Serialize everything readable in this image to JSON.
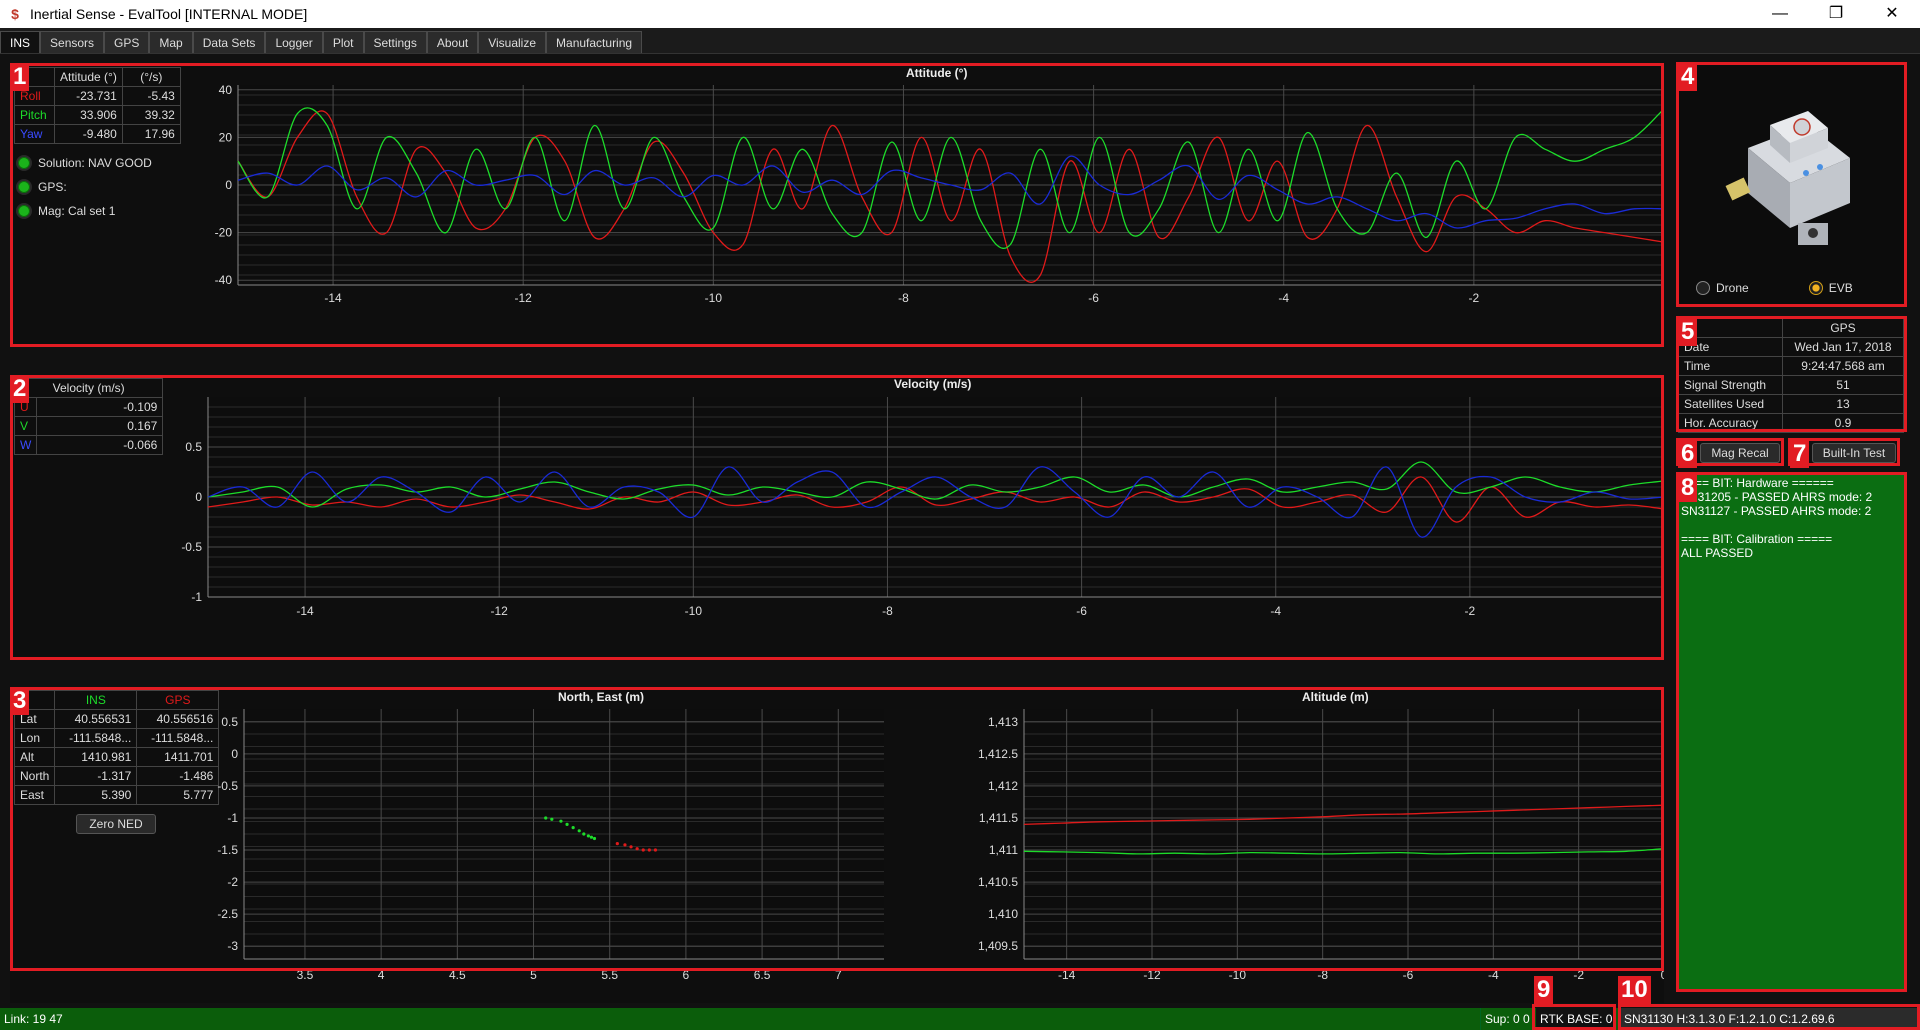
{
  "window": {
    "title": "Inertial Sense - EvalTool [INTERNAL MODE]",
    "minimize": "—",
    "maximize": "❐",
    "close": "✕"
  },
  "menu": [
    "INS",
    "Sensors",
    "GPS",
    "Map",
    "Data Sets",
    "Logger",
    "Plot",
    "Settings",
    "About",
    "Visualize",
    "Manufacturing"
  ],
  "badges": [
    "1",
    "2",
    "3",
    "4",
    "5",
    "6",
    "7",
    "8",
    "9",
    "10"
  ],
  "attitude": {
    "chart_title": "Attitude (°)",
    "headers": [
      "",
      "Attitude (°)",
      "(°/s)"
    ],
    "rows": [
      {
        "label": "Roll",
        "value": "-23.731",
        "rate": "-5.43"
      },
      {
        "label": "Pitch",
        "value": "33.906",
        "rate": "39.32"
      },
      {
        "label": "Yaw",
        "value": "-9.480",
        "rate": "17.96"
      }
    ],
    "indicators": [
      "Solution: NAV GOOD",
      "GPS:",
      "Mag: Cal set 1"
    ]
  },
  "velocity": {
    "chart_title": "Velocity (m/s)",
    "header": "Velocity (m/s)",
    "rows": [
      {
        "label": "U",
        "value": "-0.109"
      },
      {
        "label": "V",
        "value": "0.167"
      },
      {
        "label": "W",
        "value": "-0.066"
      }
    ]
  },
  "position": {
    "headers": [
      "",
      "INS",
      "GPS"
    ],
    "rows": [
      {
        "label": "Lat",
        "ins": "40.556531",
        "gps": "40.556516"
      },
      {
        "label": "Lon",
        "ins": "-111.5848...",
        "gps": "-111.5848..."
      },
      {
        "label": "Alt",
        "ins": "1410.981",
        "gps": "1411.701"
      },
      {
        "label": "North",
        "ins": "-1.317",
        "gps": "-1.486"
      },
      {
        "label": "East",
        "ins": "5.390",
        "gps": "5.777"
      }
    ],
    "zero_ned_label": "Zero NED",
    "ne_title": "North, East (m)",
    "alt_title": "Altitude (m)"
  },
  "device": {
    "options": [
      "Drone",
      "EVB"
    ],
    "selected": "EVB"
  },
  "gps_info": {
    "header": "GPS",
    "rows": [
      {
        "label": "Date",
        "value": "Wed Jan 17, 2018"
      },
      {
        "label": "Time",
        "value": "9:24:47.568 am"
      },
      {
        "label": "Signal Strength",
        "value": "51"
      },
      {
        "label": "Satellites Used",
        "value": "13"
      },
      {
        "label": "Hor. Accuracy",
        "value": "0.9"
      }
    ]
  },
  "buttons": {
    "mag_recal": "Mag Recal",
    "built_in_test": "Built-In Test"
  },
  "bit_log": [
    "==== BIT: Hardware ======",
    "SN31205 - PASSED AHRS mode: 2",
    "SN31127 - PASSED AHRS mode: 2",
    "",
    "==== BIT: Calibration =====",
    "ALL PASSED"
  ],
  "status": {
    "link": "Link: 19 47",
    "sup": "Sup: 0 0",
    "rtk": "RTK BASE: 0",
    "version": "SN31130 H:3.1.3.0  F:1.2.1.0  C:1.2.69.6"
  },
  "colors": {
    "roll": "#e01a1a",
    "pitch": "#1ddc2a",
    "yaw": "#1a2bd6",
    "accent_red": "#e21c23",
    "status_green": "#0b5d0b"
  },
  "chart_data": [
    {
      "type": "line",
      "title": "Attitude (°)",
      "xlim": [
        -15,
        0
      ],
      "ylim": [
        -42,
        42
      ],
      "x_ticks": [
        "-14",
        "-12",
        "-10",
        "-8",
        "-6",
        "-4",
        "-2",
        "0"
      ],
      "y_ticks": [
        "40",
        "20",
        "0",
        "-20",
        "-40"
      ],
      "series": [
        {
          "name": "Roll",
          "color": "#e01a1a",
          "values": [
            10,
            -5,
            20,
            30,
            -5,
            -20,
            15,
            5,
            -18,
            -10,
            20,
            10,
            -22,
            -10,
            18,
            5,
            -20,
            -25,
            15,
            -10,
            25,
            -5,
            -20,
            20,
            -15,
            15,
            -30,
            -38,
            10,
            -20,
            15,
            -22,
            -5,
            20,
            -15,
            10,
            -22,
            -10,
            25,
            -5,
            -28,
            -5,
            -10,
            -20,
            -15,
            -18,
            -20,
            -22,
            -24
          ]
        },
        {
          "name": "Pitch",
          "color": "#1ddc2a",
          "values": [
            10,
            -5,
            30,
            25,
            -10,
            20,
            5,
            -20,
            15,
            -10,
            20,
            -15,
            25,
            -10,
            20,
            -5,
            -18,
            20,
            -10,
            15,
            -12,
            -20,
            18,
            -15,
            20,
            -15,
            -25,
            15,
            -20,
            20,
            -20,
            -10,
            18,
            -20,
            15,
            -15,
            22,
            -10,
            -20,
            5,
            -22,
            10,
            -10,
            20,
            15,
            10,
            15,
            20,
            32
          ]
        },
        {
          "name": "Yaw",
          "color": "#1a2bd6",
          "values": [
            2,
            5,
            0,
            8,
            -2,
            3,
            -5,
            6,
            0,
            2,
            4,
            -4,
            6,
            0,
            3,
            -5,
            4,
            0,
            8,
            -3,
            2,
            -4,
            6,
            3,
            0,
            -2,
            5,
            -8,
            12,
            0,
            -4,
            2,
            8,
            -6,
            4,
            -2,
            -8,
            -5,
            -10,
            -15,
            -12,
            -18,
            -15,
            -14,
            -10,
            -8,
            -12,
            -10,
            -10
          ]
        }
      ]
    },
    {
      "type": "line",
      "title": "Velocity (m/s)",
      "xlim": [
        -15,
        0
      ],
      "ylim": [
        -1,
        1
      ],
      "x_ticks": [
        "-14",
        "-12",
        "-10",
        "-8",
        "-6",
        "-4",
        "-2",
        "0"
      ],
      "y_ticks": [
        "0.5",
        "0",
        "-0.5",
        "-1"
      ],
      "series": [
        {
          "name": "U",
          "color": "#e01a1a",
          "values": [
            -0.1,
            -0.05,
            0,
            -0.08,
            -0.05,
            -0.1,
            -0.02,
            -0.1,
            -0.05,
            0.02,
            -0.05,
            -0.12,
            0,
            -0.05,
            0.05,
            -0.08,
            -0.05,
            0.02,
            -0.1,
            -0.05,
            0.1,
            -0.08,
            -0.02,
            0.05,
            -0.05,
            0,
            -0.1,
            0.05,
            -0.05,
            0,
            0.08,
            -0.1,
            -0.05,
            0.02,
            -0.15,
            0.2,
            -0.25,
            0.1,
            -0.2,
            -0.05,
            -0.1,
            -0.08,
            -0.12
          ]
        },
        {
          "name": "V",
          "color": "#1ddc2a",
          "values": [
            0,
            0.05,
            0.1,
            -0.1,
            0.08,
            0.12,
            0.05,
            0.1,
            0,
            0.08,
            0.15,
            0.05,
            -0.02,
            0.08,
            0.12,
            0.02,
            0.1,
            0.05,
            0,
            0.15,
            0.08,
            -0.02,
            0.12,
            0.05,
            0.1,
            0.2,
            0.05,
            0.12,
            0,
            0.1,
            0.18,
            0.05,
            0.1,
            0.15,
            0.08,
            0.35,
            0.05,
            0.1,
            0.2,
            0.1,
            0.05,
            0.12,
            0.16
          ]
        },
        {
          "name": "W",
          "color": "#1a2bd6",
          "values": [
            0,
            0.1,
            -0.1,
            0.25,
            -0.05,
            0.2,
            0.05,
            -0.15,
            0.2,
            -0.05,
            0.25,
            -0.1,
            0.1,
            0.05,
            -0.2,
            0.3,
            -0.05,
            0.15,
            0.25,
            -0.1,
            0.05,
            0.2,
            0,
            -0.1,
            0.3,
            0.05,
            -0.2,
            0.2,
            0,
            0.25,
            -0.1,
            0.1,
            0,
            -0.2,
            0.3,
            -0.4,
            0.1,
            0.2,
            0,
            -0.05,
            0.05,
            -0.02,
            0
          ]
        }
      ]
    },
    {
      "type": "scatter",
      "title": "North, East (m)",
      "xlim": [
        3.1,
        7.3
      ],
      "ylim": [
        -3.2,
        0.7
      ],
      "x_ticks": [
        "3.5",
        "4",
        "4.5",
        "5",
        "5.5",
        "6",
        "6.5",
        "7"
      ],
      "y_ticks": [
        "0.5",
        "0",
        "-0.5",
        "-1",
        "-1.5",
        "-2",
        "-2.5",
        "-3"
      ],
      "series": [
        {
          "name": "INS",
          "color": "#1ddc2a",
          "x": [
            5.08,
            5.12,
            5.18,
            5.22,
            5.26,
            5.3,
            5.33,
            5.36,
            5.38,
            5.4
          ],
          "y": [
            -1.0,
            -1.02,
            -1.05,
            -1.1,
            -1.15,
            -1.2,
            -1.25,
            -1.28,
            -1.3,
            -1.32
          ]
        },
        {
          "name": "GPS",
          "color": "#e01a1a",
          "x": [
            5.55,
            5.6,
            5.64,
            5.68,
            5.72,
            5.76,
            5.8
          ],
          "y": [
            -1.4,
            -1.42,
            -1.45,
            -1.48,
            -1.5,
            -1.5,
            -1.5
          ]
        }
      ]
    },
    {
      "type": "line",
      "title": "Altitude (m)",
      "xlim": [
        -15,
        0
      ],
      "ylim": [
        1409.3,
        1413.2
      ],
      "x_ticks": [
        "-14",
        "-12",
        "-10",
        "-8",
        "-6",
        "-4",
        "-2",
        "0"
      ],
      "y_ticks": [
        "1,413",
        "1,412.5",
        "1,412",
        "1,411.5",
        "1,411",
        "1,410.5",
        "1,410",
        "1,409.5"
      ],
      "series": [
        {
          "name": "INS",
          "color": "#1ddc2a",
          "values": [
            1410.98,
            1410.97,
            1410.96,
            1410.94,
            1410.95,
            1410.94,
            1410.96,
            1410.95,
            1410.94,
            1410.95,
            1410.96,
            1410.94,
            1410.95,
            1410.95,
            1410.96,
            1410.97,
            1410.98,
            1411.02
          ]
        },
        {
          "name": "GPS",
          "color": "#e01a1a",
          "values": [
            1411.4,
            1411.42,
            1411.44,
            1411.45,
            1411.46,
            1411.47,
            1411.48,
            1411.5,
            1411.52,
            1411.55,
            1411.56,
            1411.58,
            1411.6,
            1411.62,
            1411.64,
            1411.66,
            1411.68,
            1411.7
          ]
        }
      ]
    }
  ]
}
